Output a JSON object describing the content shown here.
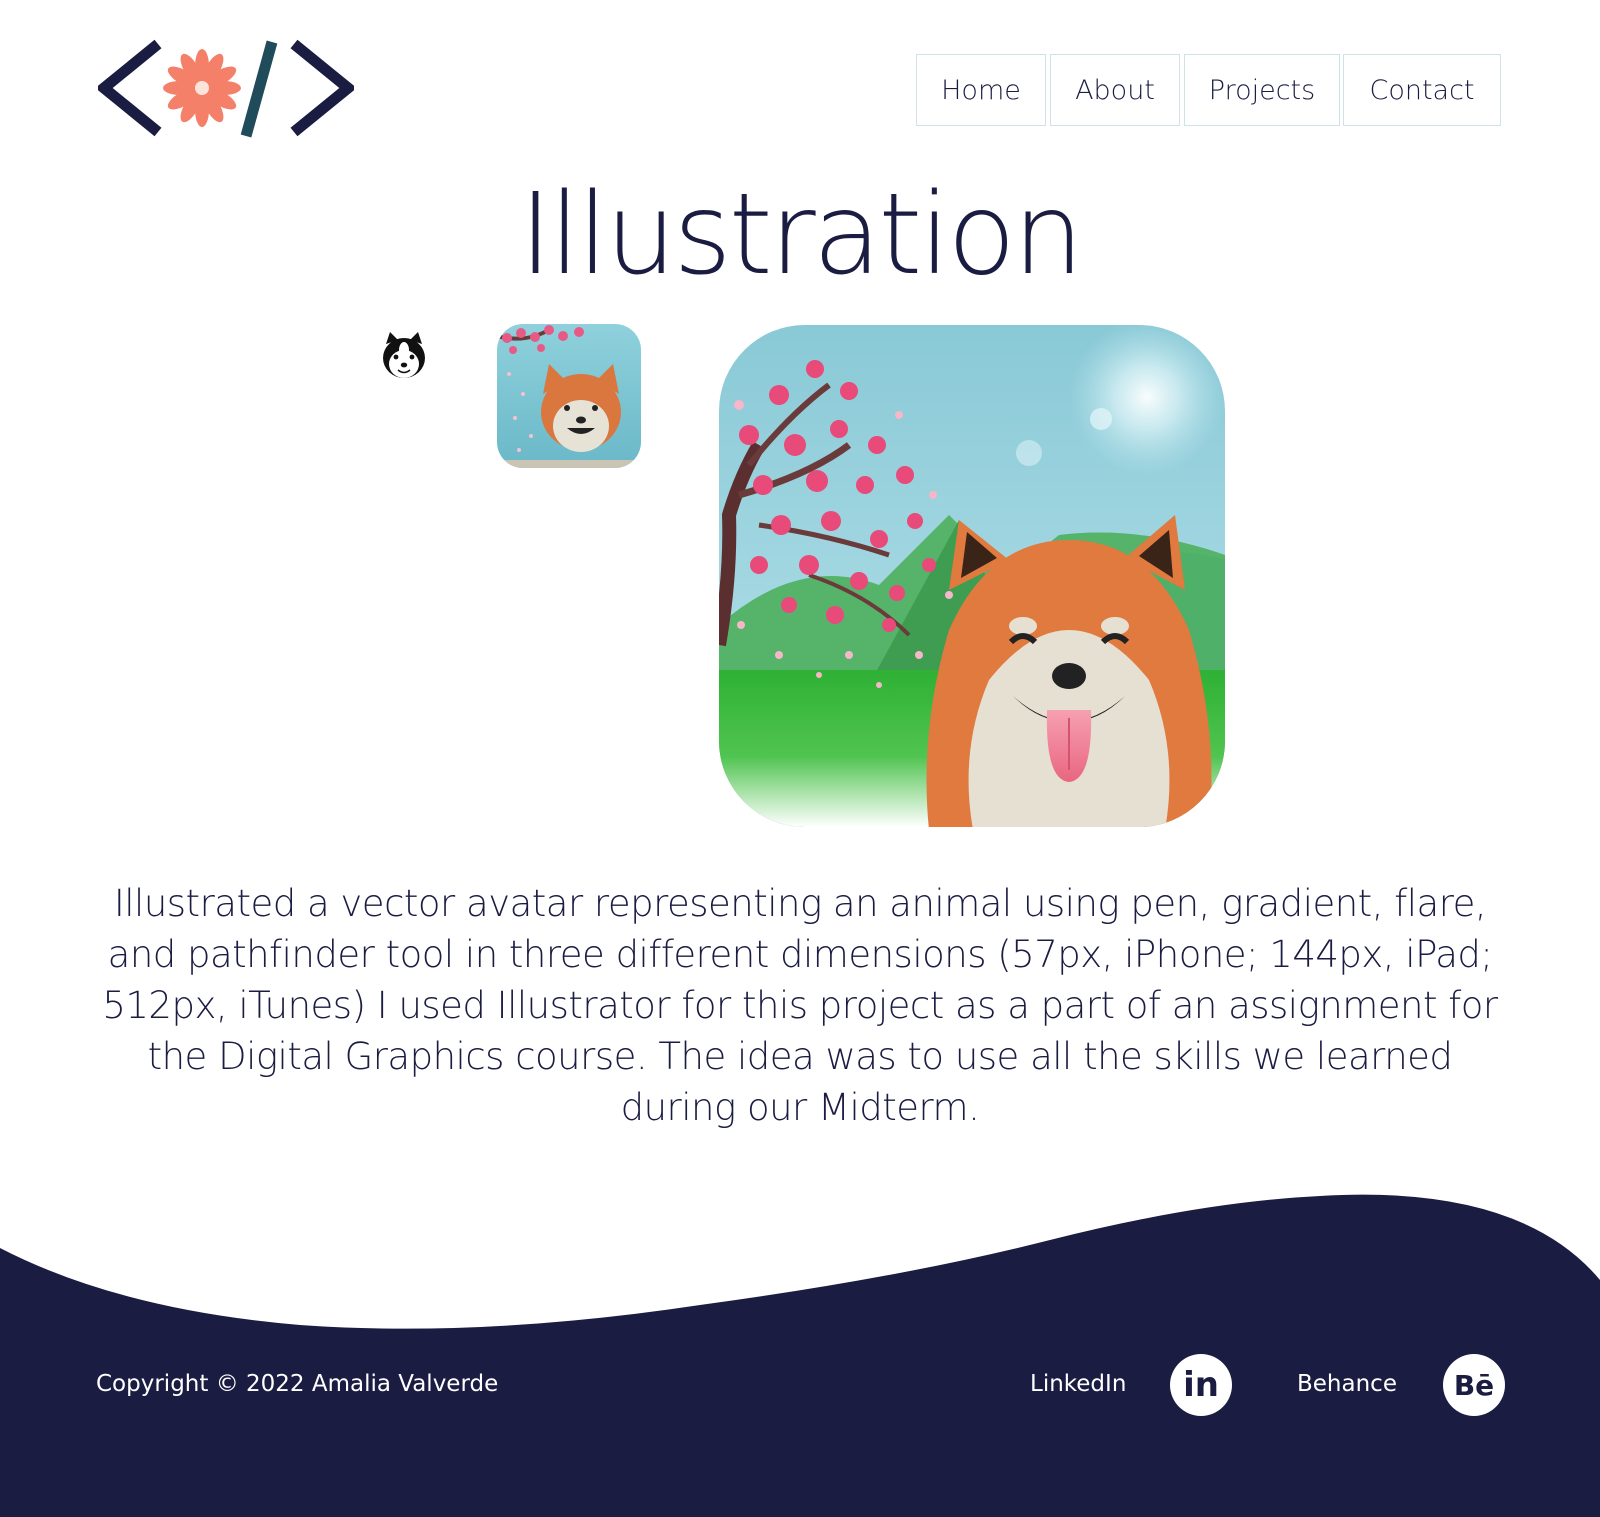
{
  "nav": {
    "items": [
      "Home",
      "About",
      "Projects",
      "Contact"
    ]
  },
  "page": {
    "title": "Illustration",
    "description": "Illustrated a vector avatar representing an animal using pen, gradient, flare, and pathfinder tool in three different dimensions (57px, iPhone; 144px, iPad; 512px, iTunes) I used Illustrator for this project as a part of an assignment for the Digital Graphics course. The idea was to use all the skills we learned during our Midterm."
  },
  "footer": {
    "copyright": "Copyright © 2022 Amalia Valverde",
    "linkedin_label": "LinkedIn",
    "linkedin_icon_text": "in",
    "behance_label": "Behance",
    "behance_icon_text": "Bē"
  },
  "colors": {
    "navy": "#1b1c42",
    "coral": "#f4806a",
    "teal": "#1f4b5a",
    "sky": "#7cc6d3"
  }
}
